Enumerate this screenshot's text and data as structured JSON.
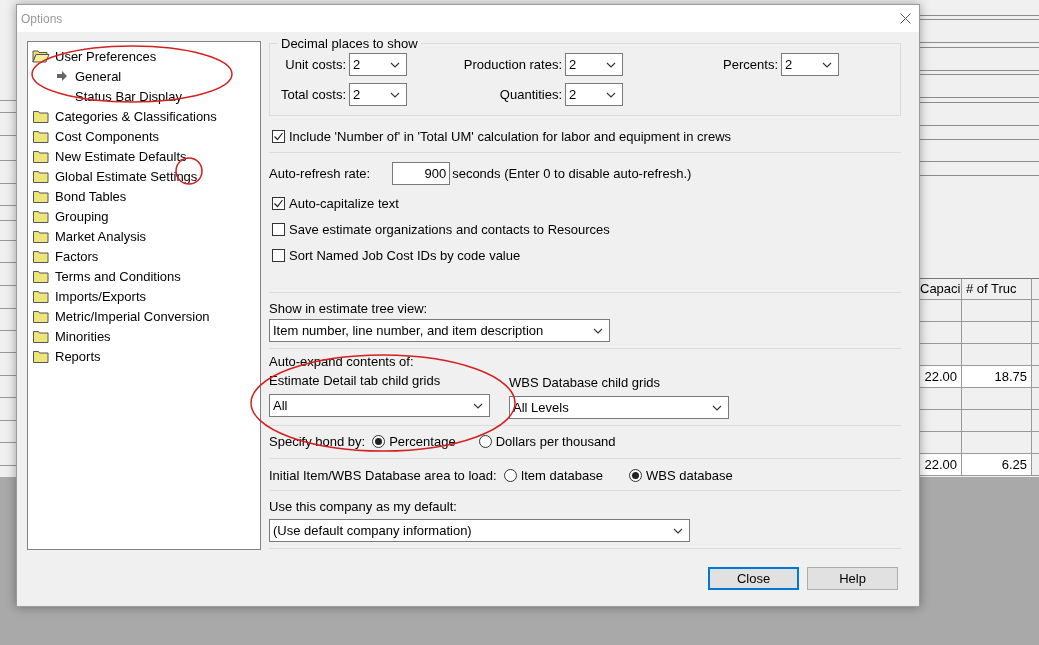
{
  "background": {
    "grid": {
      "columns": [
        "Capaci",
        "# of Truc"
      ],
      "rows": [
        {
          "filled": false
        },
        {
          "filled": false
        },
        {
          "filled": false
        },
        {
          "filled": true,
          "cells": [
            "22.00",
            "18.75"
          ]
        },
        {
          "filled": false
        },
        {
          "filled": false
        },
        {
          "filled": false
        },
        {
          "filled": true,
          "cells": [
            "22.00",
            "6.25"
          ]
        }
      ]
    }
  },
  "dialog": {
    "title": "Options",
    "tree": [
      {
        "label": "User Preferences",
        "expanded": true,
        "children": [
          {
            "label": "General",
            "selected": true
          },
          {
            "label": "Status Bar Display",
            "selected": false
          }
        ]
      },
      {
        "label": "Categories & Classifications",
        "expanded": false
      },
      {
        "label": "Cost Components",
        "expanded": false
      },
      {
        "label": "New Estimate Defaults",
        "expanded": false
      },
      {
        "label": "Global Estimate Settings",
        "expanded": false
      },
      {
        "label": "Bond Tables",
        "expanded": false
      },
      {
        "label": "Grouping",
        "expanded": false
      },
      {
        "label": "Market Analysis",
        "expanded": false
      },
      {
        "label": "Factors",
        "expanded": false
      },
      {
        "label": "Terms and Conditions",
        "expanded": false
      },
      {
        "label": "Imports/Exports",
        "expanded": false
      },
      {
        "label": "Metric/Imperial Conversion",
        "expanded": false
      },
      {
        "label": "Minorities",
        "expanded": false
      },
      {
        "label": "Reports",
        "expanded": false
      }
    ],
    "decimal_places": {
      "title": "Decimal places to show",
      "fields": [
        {
          "label": "Unit costs:",
          "value": "2"
        },
        {
          "label": "Production rates:",
          "value": "2"
        },
        {
          "label": "Percents:",
          "value": "2"
        },
        {
          "label": "Total costs:",
          "value": "2"
        },
        {
          "label": "Quantities:",
          "value": "2"
        }
      ]
    },
    "include_number_of": {
      "label": "Include 'Number of' in 'Total UM' calculation for labor and equipment in crews",
      "checked": true
    },
    "auto_refresh": {
      "label": "Auto-refresh rate:",
      "value": "900",
      "suffix": "seconds (Enter 0 to disable auto-refresh.)"
    },
    "checkboxes": [
      {
        "label": "Auto-capitalize text",
        "checked": true
      },
      {
        "label": "Save estimate organizations and contacts to Resources",
        "checked": false
      },
      {
        "label": "Sort Named Job Cost IDs by code value",
        "checked": false
      }
    ],
    "tree_view": {
      "label": "Show in estimate tree view:",
      "value": "Item number, line number, and item description"
    },
    "auto_expand": {
      "label": "Auto-expand contents of:",
      "fields": [
        {
          "label": "Estimate Detail tab child grids",
          "value": "All"
        },
        {
          "label": "WBS Database child grids",
          "value": "All Levels"
        }
      ]
    },
    "bond": {
      "label": "Specify bond by:",
      "options": [
        {
          "label": "Percentage",
          "selected": true
        },
        {
          "label": "Dollars per thousand",
          "selected": false
        }
      ]
    },
    "initial_area": {
      "label": "Initial Item/WBS Database area to load:",
      "options": [
        {
          "label": "Item database",
          "selected": false
        },
        {
          "label": "WBS database",
          "selected": true
        }
      ]
    },
    "company": {
      "label": "Use this company as my default:",
      "value": "(Use default company information)"
    },
    "buttons": [
      {
        "label": "Close",
        "default": true
      },
      {
        "label": "Help",
        "default": false
      }
    ]
  }
}
